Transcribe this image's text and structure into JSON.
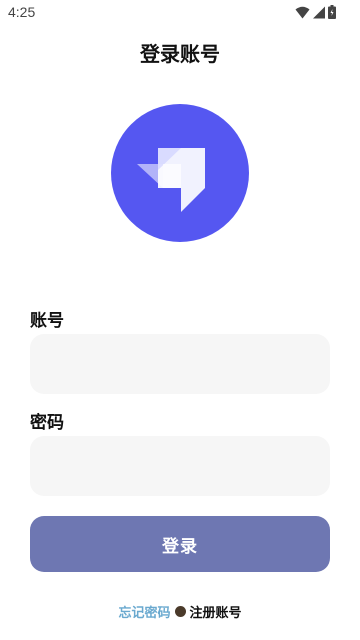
{
  "status_bar": {
    "time": "4:25",
    "icons": [
      "wifi-icon",
      "cell-signal-icon",
      "battery-icon"
    ]
  },
  "page": {
    "title": "登录账号"
  },
  "logo": {
    "icon": "app-logo-icon",
    "circle_color": "#5557f1"
  },
  "form": {
    "account_label": "账号",
    "account_value": "",
    "account_placeholder": "",
    "password_label": "密码",
    "password_value": "",
    "password_placeholder": ""
  },
  "actions": {
    "login_label": "登录",
    "login_color": "#6e77b2",
    "forgot_password": "忘记密码",
    "register": "注册账号"
  }
}
